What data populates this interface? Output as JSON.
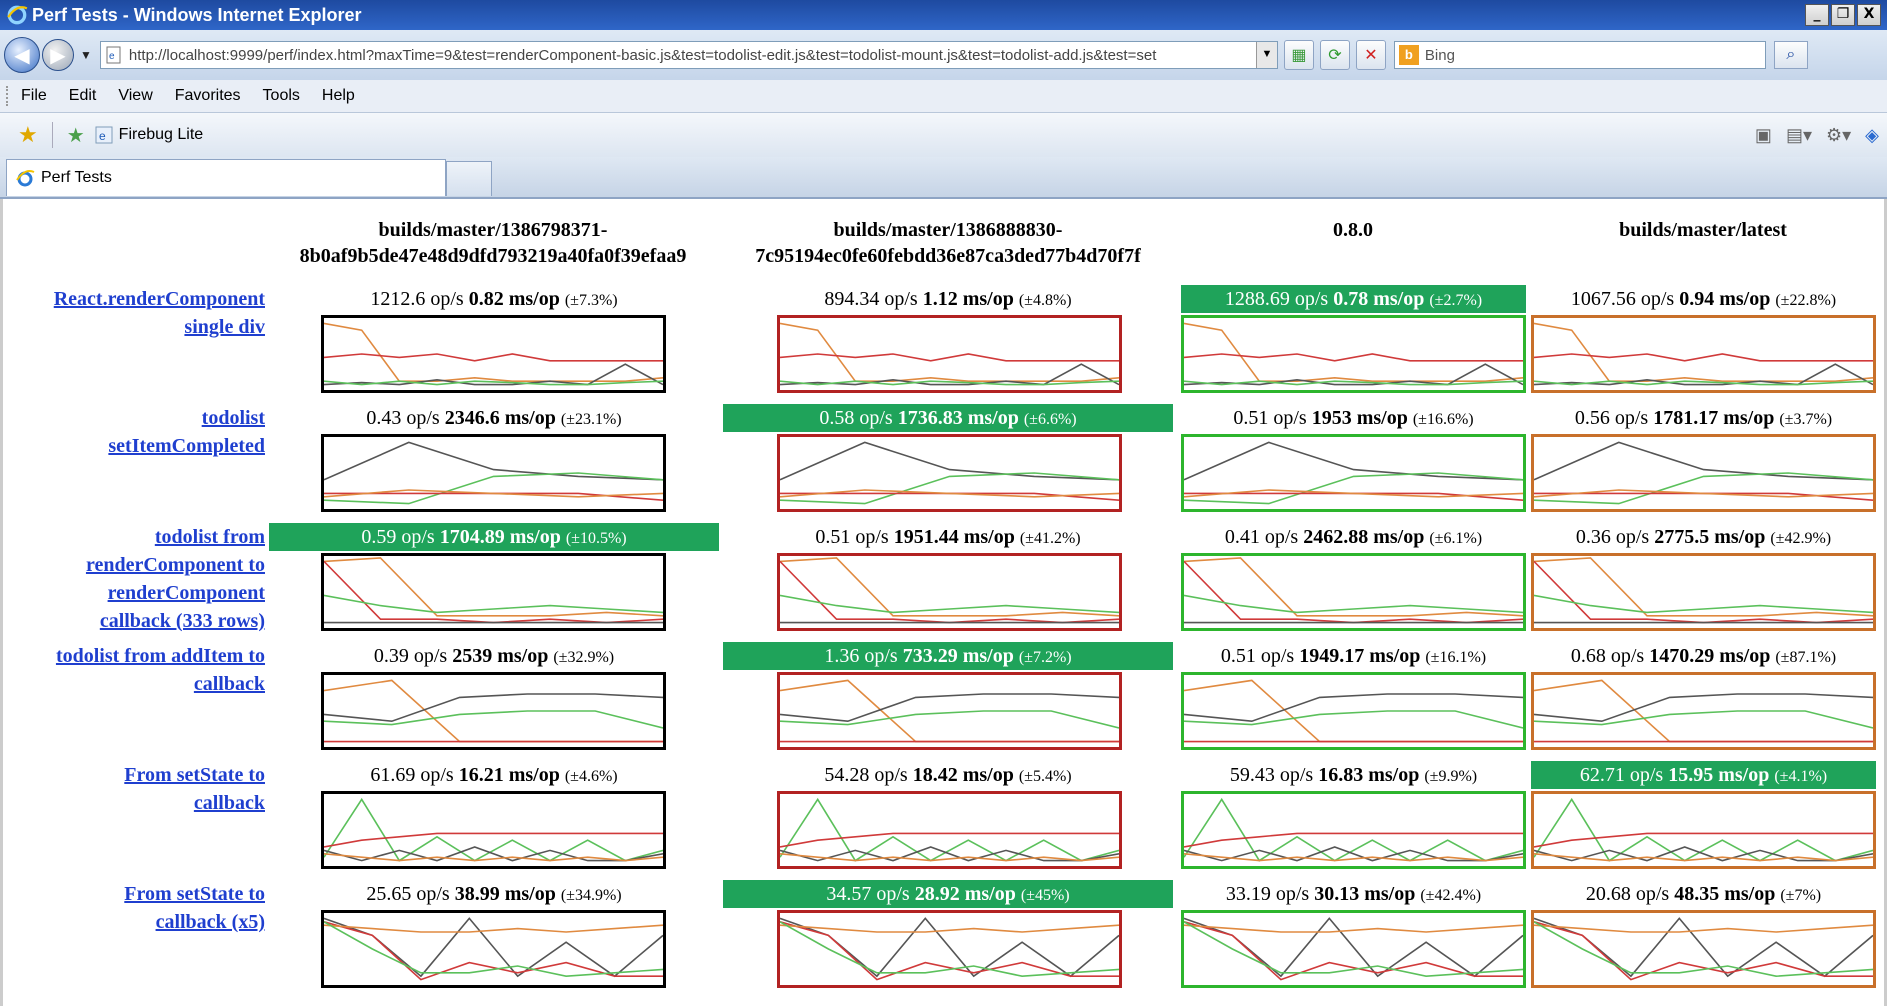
{
  "window": {
    "title": "Perf Tests - Windows Internet Explorer",
    "buttons": [
      "_",
      "❐",
      "X"
    ]
  },
  "address": {
    "url": "http://localhost:9999/perf/index.html?maxTime=9&test=renderComponent-basic.js&test=todolist-edit.js&test=todolist-mount.js&test=todolist-add.js&test=set",
    "search_placeholder": "Bing"
  },
  "menu": [
    "File",
    "Edit",
    "View",
    "Favorites",
    "Tools",
    "Help"
  ],
  "favorites": {
    "item": "Firebug Lite"
  },
  "tab": {
    "title": "Perf Tests"
  },
  "colors": {
    "col1": "#000000",
    "col2": "#b22222",
    "col3": "#2db52d",
    "col4": "#c8702a",
    "best": "#1fa35a",
    "link": "#1f3fcf"
  },
  "columns": [
    {
      "line1": "builds/master/1386798371-",
      "line2": "8b0af9b5de47e48d9dfd793219a40fa0f39efaa9"
    },
    {
      "line1": "builds/master/1386888830-",
      "line2": "7c95194ec0fe60febdd36e87ca3ded77b4d70f7f"
    },
    {
      "line1": "0.8.0",
      "line2": ""
    },
    {
      "line1": "builds/master/latest",
      "line2": ""
    }
  ],
  "rows": [
    {
      "label": [
        "React.renderComponent",
        "single div"
      ],
      "cells": [
        {
          "ops": "1212.6",
          "ms": "0.82",
          "pct": "(±7.3%)",
          "best": false
        },
        {
          "ops": "894.34",
          "ms": "1.12",
          "pct": "(±4.8%)",
          "best": false
        },
        {
          "ops": "1288.69",
          "ms": "0.78",
          "pct": "(±2.7%)",
          "best": true
        },
        {
          "ops": "1067.56",
          "ms": "0.94",
          "pct": "(±22.8%)",
          "best": false
        }
      ],
      "series": {
        "orange": [
          0.95,
          0.85,
          0.1,
          0.1,
          0.15,
          0.1,
          0.1,
          0.1,
          0.1,
          0.15
        ],
        "red": [
          0.45,
          0.5,
          0.45,
          0.5,
          0.4,
          0.5,
          0.4,
          0.4,
          0.4,
          0.4
        ],
        "black": [
          0.05,
          0.08,
          0.05,
          0.12,
          0.05,
          0.05,
          0.1,
          0.05,
          0.35,
          0.05
        ],
        "green": [
          0.1,
          0.05,
          0.1,
          0.05,
          0.1,
          0.08,
          0.05,
          0.05,
          0.08,
          0.1
        ]
      }
    },
    {
      "label": [
        "todolist",
        "setItemCompleted"
      ],
      "cells": [
        {
          "ops": "0.43",
          "ms": "2346.6",
          "pct": "(±23.1%)",
          "best": false
        },
        {
          "ops": "0.58",
          "ms": "1736.83",
          "pct": "(±6.6%)",
          "best": true
        },
        {
          "ops": "0.51",
          "ms": "1953",
          "pct": "(±16.6%)",
          "best": false
        },
        {
          "ops": "0.56",
          "ms": "1781.17",
          "pct": "(±3.7%)",
          "best": false
        }
      ],
      "series": {
        "black": [
          0.4,
          0.95,
          0.55,
          0.45,
          0.4
        ],
        "green": [
          0.1,
          0.05,
          0.45,
          0.5,
          0.4
        ],
        "red": [
          0.2,
          0.2,
          0.2,
          0.2,
          0.1
        ],
        "orange": [
          0.15,
          0.25,
          0.2,
          0.15,
          0.2
        ]
      }
    },
    {
      "label": [
        "todolist from",
        "renderComponent to",
        "renderComponent",
        "callback (333 rows)"
      ],
      "cells": [
        {
          "ops": "0.59",
          "ms": "1704.89",
          "pct": "(±10.5%)",
          "best": true
        },
        {
          "ops": "0.51",
          "ms": "1951.44",
          "pct": "(±41.2%)",
          "best": false
        },
        {
          "ops": "0.41",
          "ms": "2462.88",
          "pct": "(±6.1%)",
          "best": false
        },
        {
          "ops": "0.36",
          "ms": "2775.5",
          "pct": "(±42.9%)",
          "best": false
        }
      ],
      "series": {
        "orange": [
          0.95,
          1.0,
          0.15,
          0.15,
          0.15,
          0.2,
          0.15
        ],
        "red": [
          0.95,
          0.1,
          0.1,
          0.05,
          0.1,
          0.05,
          0.1
        ],
        "green": [
          0.45,
          0.3,
          0.2,
          0.25,
          0.3,
          0.25,
          0.2
        ],
        "black": [
          0.05,
          0.05,
          0.05,
          0.05,
          0.05,
          0.05,
          0.05
        ]
      }
    },
    {
      "label": [
        "todolist from addItem to",
        "callback"
      ],
      "cells": [
        {
          "ops": "0.39",
          "ms": "2539",
          "pct": "(±32.9%)",
          "best": false
        },
        {
          "ops": "1.36",
          "ms": "733.29",
          "pct": "(±7.2%)",
          "best": true
        },
        {
          "ops": "0.51",
          "ms": "1949.17",
          "pct": "(±16.1%)",
          "best": false
        },
        {
          "ops": "0.68",
          "ms": "1470.29",
          "pct": "(±87.1%)",
          "best": false
        }
      ],
      "series": {
        "orange": [
          0.8,
          0.95,
          0.05,
          0.05,
          0.05,
          0.05
        ],
        "black": [
          0.45,
          0.35,
          0.7,
          0.75,
          0.75,
          0.7
        ],
        "green": [
          0.35,
          0.3,
          0.45,
          0.5,
          0.5,
          0.25
        ],
        "red": [
          0.05,
          0.05,
          0.05,
          0.05,
          0.05,
          0.05
        ]
      }
    },
    {
      "label": [
        "From setState to",
        "callback"
      ],
      "cells": [
        {
          "ops": "61.69",
          "ms": "16.21",
          "pct": "(±4.6%)",
          "best": false
        },
        {
          "ops": "54.28",
          "ms": "18.42",
          "pct": "(±5.4%)",
          "best": false
        },
        {
          "ops": "59.43",
          "ms": "16.83",
          "pct": "(±9.9%)",
          "best": false
        },
        {
          "ops": "62.71",
          "ms": "15.95",
          "pct": "(±4.1%)",
          "best": true
        }
      ],
      "series": {
        "green": [
          0.1,
          0.95,
          0.05,
          0.4,
          0.05,
          0.35,
          0.05,
          0.35,
          0.05,
          0.2
        ],
        "red": [
          0.25,
          0.35,
          0.4,
          0.45,
          0.45,
          0.45,
          0.45,
          0.45,
          0.45,
          0.45
        ],
        "black": [
          0.2,
          0.05,
          0.2,
          0.05,
          0.25,
          0.05,
          0.2,
          0.05,
          0.05,
          0.15
        ],
        "orange": [
          0.15,
          0.1,
          0.05,
          0.1,
          0.05,
          0.1,
          0.05,
          0.1,
          0.05,
          0.1
        ]
      }
    },
    {
      "label": [
        "From setState to",
        "callback (x5)"
      ],
      "cells": [
        {
          "ops": "25.65",
          "ms": "38.99",
          "pct": "(±34.9%)",
          "best": false
        },
        {
          "ops": "34.57",
          "ms": "28.92",
          "pct": "(±45%)",
          "best": true
        },
        {
          "ops": "33.19",
          "ms": "30.13",
          "pct": "(±42.4%)",
          "best": false
        },
        {
          "ops": "20.68",
          "ms": "48.35",
          "pct": "(±7%)",
          "best": false
        }
      ],
      "series": {
        "black": [
          0.95,
          0.7,
          0.1,
          0.95,
          0.1,
          0.6,
          0.1,
          0.7
        ],
        "red": [
          0.9,
          0.7,
          0.05,
          0.3,
          0.15,
          0.3,
          0.1,
          0.1
        ],
        "orange": [
          0.85,
          0.8,
          0.75,
          0.75,
          0.8,
          0.75,
          0.8,
          0.85
        ],
        "green": [
          0.9,
          0.5,
          0.15,
          0.15,
          0.25,
          0.1,
          0.15,
          0.2
        ]
      }
    }
  ]
}
